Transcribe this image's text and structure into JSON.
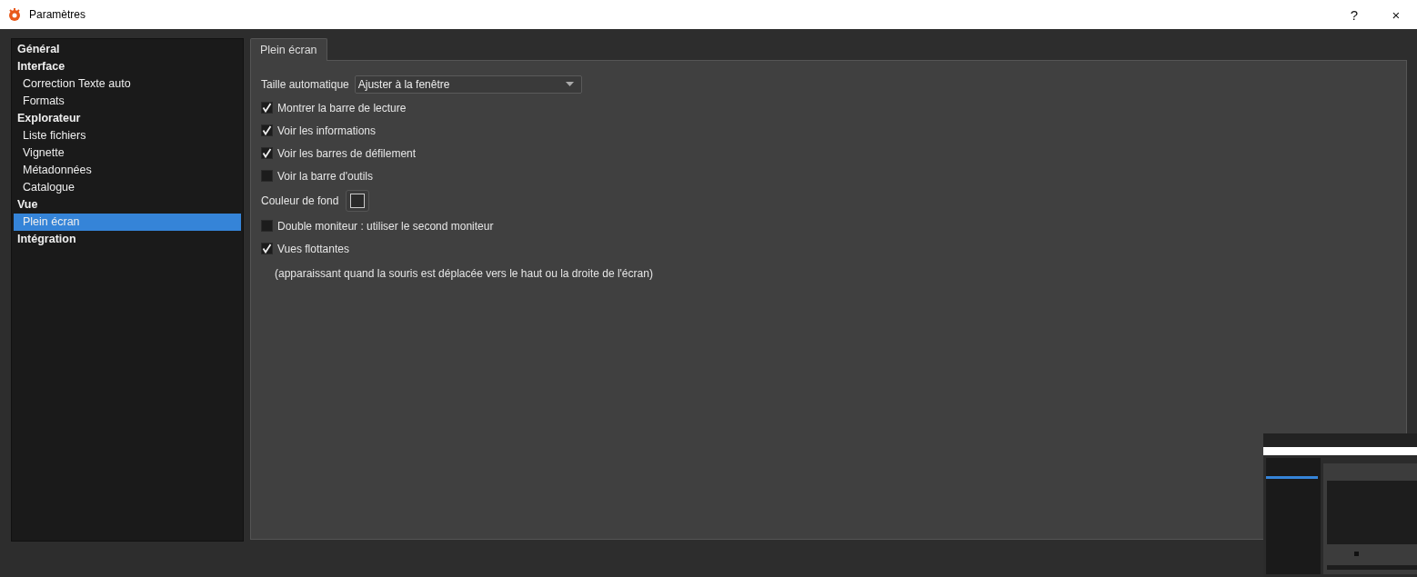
{
  "window": {
    "title": "Paramètres",
    "buttons": [
      "?",
      "×"
    ]
  },
  "sidebar": {
    "items": [
      {
        "label": "Général",
        "selected": false
      },
      {
        "label": "Interface",
        "selected": false,
        "children": [
          {
            "label": "Correction Texte auto",
            "selected": false
          },
          {
            "label": "Formats",
            "selected": false
          }
        ]
      },
      {
        "label": "Explorateur",
        "selected": false,
        "children": [
          {
            "label": "Liste fichiers",
            "selected": false
          },
          {
            "label": "Vignette",
            "selected": false
          },
          {
            "label": "Métadonnées",
            "selected": false
          },
          {
            "label": "Catalogue",
            "selected": false
          }
        ]
      },
      {
        "label": "Vue",
        "selected": false,
        "children": [
          {
            "label": "Plein écran",
            "selected": true
          }
        ]
      },
      {
        "label": "Intégration",
        "selected": false
      }
    ]
  },
  "tabs": [
    {
      "label": "Plein écran",
      "selected": true
    }
  ],
  "settings": [
    {
      "kind": "select",
      "label": "Taille automatique",
      "value": "Ajuster à la fenêtre"
    },
    {
      "kind": "checkbox",
      "label": "Montrer la barre de lecture",
      "checked": true
    },
    {
      "kind": "checkbox",
      "label": "Voir les informations",
      "checked": true
    },
    {
      "kind": "checkbox",
      "label": "Voir les barres de défilement",
      "checked": true
    },
    {
      "kind": "checkbox",
      "label": "Voir la barre d'outils",
      "checked": false
    },
    {
      "kind": "color",
      "label": "Couleur de fond",
      "color": "#2a2a2a"
    },
    {
      "kind": "checkbox",
      "label": "Double moniteur : utiliser le second moniteur",
      "checked": false
    },
    {
      "kind": "checkbox",
      "label": "Vues flottantes",
      "checked": true
    },
    {
      "kind": "note",
      "label": "(apparaissant quand la souris est déplacée vers le haut ou la droite de l'écran)"
    }
  ]
}
